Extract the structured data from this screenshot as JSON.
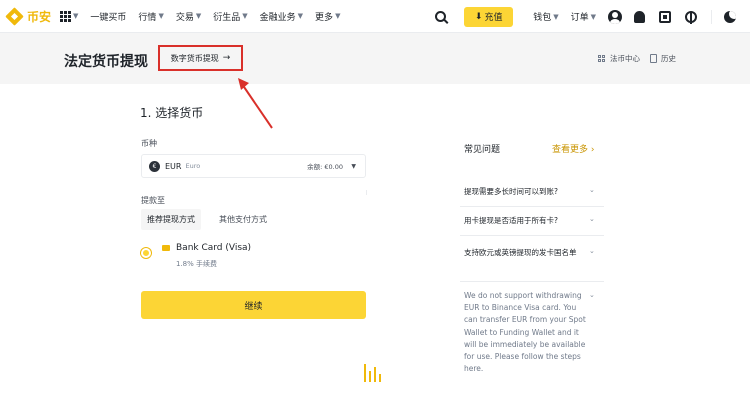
{
  "nav": {
    "logo_text": "币安",
    "items": [
      "一键买币",
      "行情",
      "交易",
      "衍生品",
      "金融业务",
      "更多"
    ],
    "deposit_label": "充值",
    "wallet_label": "钱包",
    "orders_label": "订单"
  },
  "header": {
    "title": "法定货币提现",
    "crypto_withdraw_link": "数字货币提现",
    "link_fiat_center": "法币中心",
    "link_history": "历史"
  },
  "form": {
    "step_title": "1. 选择货币",
    "coin_label": "币种",
    "coin_badge": "€",
    "coin_code": "EUR",
    "coin_name": "Euro",
    "coin_balance": "余额: €0.00",
    "withdraw_to_label": "提款至",
    "tabs": [
      "推荐提现方式",
      "其他支付方式"
    ],
    "method_name": "Bank Card (Visa)",
    "method_fee": "1.8% 手续费",
    "continue_label": "继续"
  },
  "faq": {
    "title": "常见问题",
    "see_more": "查看更多 ›",
    "items": [
      "提现需要多长时间可以到账?",
      "用卡提现是否适用于所有卡?",
      "支持欧元或英镑提现的发卡国名单"
    ],
    "answer": "We do not support withdrawing EUR to Binance Visa card. You can transfer EUR from your Spot Wallet to Funding Wallet and it will be immediately be available for use. Please follow the steps here."
  },
  "colors": {
    "brand_yellow": "#fcd535",
    "brand_gold": "#f0b90b",
    "annotation_red": "#d9302a",
    "link_gold": "#c99400"
  }
}
